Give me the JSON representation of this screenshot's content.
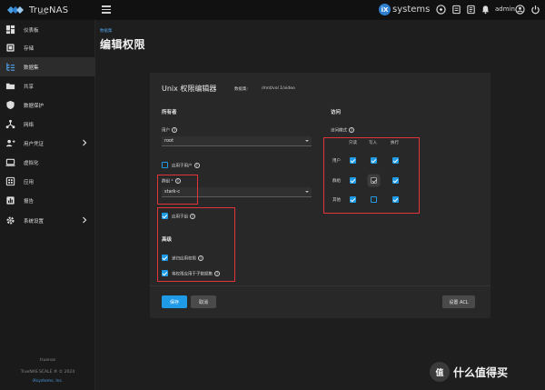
{
  "app": {
    "brand": "TrueNAS",
    "brand_sub": "SCALE"
  },
  "topbar": {
    "vendor": "systems",
    "vendor_badge": "iX",
    "user": "admin"
  },
  "sidebar": {
    "items": [
      {
        "label": "仪表板",
        "icon": "dashboard-icon"
      },
      {
        "label": "存储",
        "icon": "storage-icon"
      },
      {
        "label": "数据集",
        "icon": "datasets-icon"
      },
      {
        "label": "共享",
        "icon": "shares-icon"
      },
      {
        "label": "数据保护",
        "icon": "data-protection-icon"
      },
      {
        "label": "网络",
        "icon": "network-icon"
      },
      {
        "label": "用户凭证",
        "icon": "credentials-icon"
      },
      {
        "label": "虚拟化",
        "icon": "virtualization-icon"
      },
      {
        "label": "应用",
        "icon": "apps-icon"
      },
      {
        "label": "报告",
        "icon": "reporting-icon"
      },
      {
        "label": "系统设置",
        "icon": "settings-icon"
      }
    ],
    "footer_host": "truenas",
    "footer_copyright": "TrueNAS SCALE ® © 2024",
    "footer_company": "iXsystems, Inc."
  },
  "page": {
    "breadcrumb": "数据集",
    "title": "编辑权限"
  },
  "editor": {
    "title": "Unix 权限编辑器",
    "dataset_label": "数据集:",
    "dataset_path": "/mnt/vol 1/video",
    "owner_section": "所有者",
    "user_label": "用户",
    "user_value": "root",
    "apply_user_label": "应用于用户",
    "group_label": "群组 *",
    "group_value": "stark-c",
    "apply_group_label": "应用于组",
    "advanced_section": "高级",
    "recursive_label": "递归应用权限",
    "child_label": "将权限应用于子数据集",
    "access_section": "访问",
    "access_mode_label": "访问模式",
    "col_read": "只读",
    "col_write": "写入",
    "col_exec": "执行",
    "row_user": "用户",
    "row_group": "群组",
    "row_other": "其他",
    "save_label": "保存",
    "cancel_label": "取消",
    "acl_label": "设置 ACL"
  },
  "watermark": {
    "badge": "值",
    "text": "什么值得买"
  },
  "colors": {
    "accent": "#1f9ae6",
    "highlight": "#e0333a",
    "background": "#1e1e1e",
    "card": "#282828"
  }
}
